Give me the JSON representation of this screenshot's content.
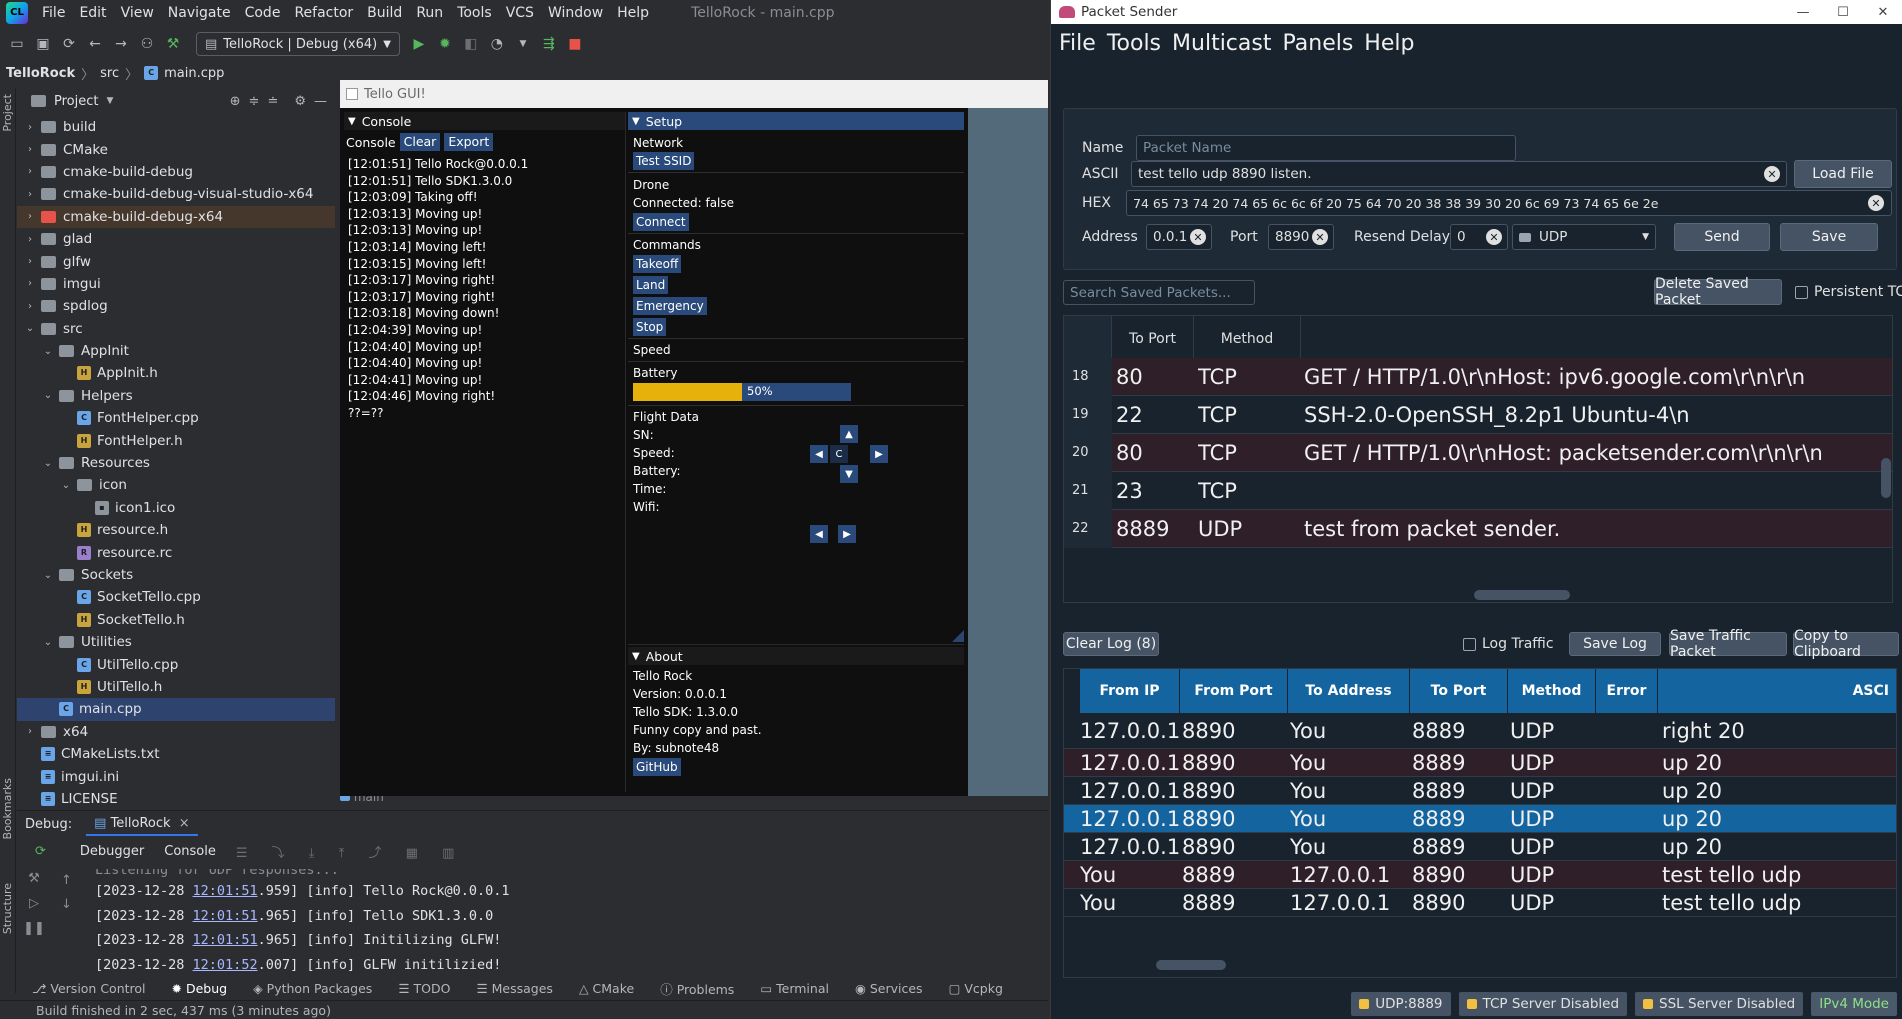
{
  "clion": {
    "menu": [
      "File",
      "Edit",
      "View",
      "Navigate",
      "Code",
      "Refactor",
      "Build",
      "Run",
      "Tools",
      "VCS",
      "Window",
      "Help"
    ],
    "window_title": "TelloRock - main.cpp",
    "run_config": "TelloRock | Debug (x64)",
    "breadcrumb": {
      "project": "TelloRock",
      "folder": "src",
      "file": "main.cpp"
    },
    "project_panel_title": "Project",
    "tree": [
      {
        "label": "build",
        "type": "folder",
        "depth": 1,
        "expanded": false
      },
      {
        "label": "CMake",
        "type": "folder",
        "depth": 1,
        "expanded": false
      },
      {
        "label": "cmake-build-debug",
        "type": "folder",
        "depth": 1,
        "expanded": false
      },
      {
        "label": "cmake-build-debug-visual-studio-x64",
        "type": "folder",
        "depth": 1,
        "expanded": false
      },
      {
        "label": "cmake-build-debug-x64",
        "type": "folder-red",
        "depth": 1,
        "expanded": false,
        "highlight": true
      },
      {
        "label": "glad",
        "type": "folder",
        "depth": 1,
        "expanded": false
      },
      {
        "label": "glfw",
        "type": "folder",
        "depth": 1,
        "expanded": false
      },
      {
        "label": "imgui",
        "type": "folder",
        "depth": 1,
        "expanded": false
      },
      {
        "label": "spdlog",
        "type": "folder",
        "depth": 1,
        "expanded": false
      },
      {
        "label": "src",
        "type": "folder",
        "depth": 1,
        "expanded": true
      },
      {
        "label": "AppInit",
        "type": "folder",
        "depth": 2,
        "expanded": true
      },
      {
        "label": "AppInit.h",
        "type": "h",
        "depth": 3
      },
      {
        "label": "Helpers",
        "type": "folder",
        "depth": 2,
        "expanded": true
      },
      {
        "label": "FontHelper.cpp",
        "type": "cpp",
        "depth": 3
      },
      {
        "label": "FontHelper.h",
        "type": "h",
        "depth": 3
      },
      {
        "label": "Resources",
        "type": "folder",
        "depth": 2,
        "expanded": true
      },
      {
        "label": "icon",
        "type": "folder",
        "depth": 3,
        "expanded": true
      },
      {
        "label": "icon1.ico",
        "type": "ico",
        "depth": 4
      },
      {
        "label": "resource.h",
        "type": "h",
        "depth": 3
      },
      {
        "label": "resource.rc",
        "type": "rc",
        "depth": 3
      },
      {
        "label": "Sockets",
        "type": "folder",
        "depth": 2,
        "expanded": true
      },
      {
        "label": "SocketTello.cpp",
        "type": "cpp",
        "depth": 3
      },
      {
        "label": "SocketTello.h",
        "type": "h",
        "depth": 3
      },
      {
        "label": "Utilities",
        "type": "folder",
        "depth": 2,
        "expanded": true
      },
      {
        "label": "UtilTello.cpp",
        "type": "cpp",
        "depth": 3
      },
      {
        "label": "UtilTello.h",
        "type": "h",
        "depth": 3
      },
      {
        "label": "main.cpp",
        "type": "cpp",
        "depth": 2,
        "selected": true
      },
      {
        "label": "x64",
        "type": "folder",
        "depth": 1,
        "expanded": false
      },
      {
        "label": "CMakeLists.txt",
        "type": "txt",
        "depth": 1
      },
      {
        "label": "imgui.ini",
        "type": "txt",
        "depth": 1
      },
      {
        "label": "LICENSE",
        "type": "txt",
        "depth": 1
      }
    ],
    "editor_tab": "main",
    "debug": {
      "label": "Debug:",
      "config_tab": "TelloRock",
      "subtabs": [
        "Debugger",
        "Console"
      ],
      "log_partial": "Listening for UDP responses...",
      "log": [
        {
          "date": "[2023-12-28 ",
          "time": "12:01:51",
          "rest": ".959] [info] Tello Rock@0.0.0.1"
        },
        {
          "date": "[2023-12-28 ",
          "time": "12:01:51",
          "rest": ".965] [info] Tello SDK1.3.0.0"
        },
        {
          "date": "[2023-12-28 ",
          "time": "12:01:51",
          "rest": ".965] [info] Initilizing GLFW!"
        },
        {
          "date": "[2023-12-28 ",
          "time": "12:01:52",
          "rest": ".007] [info] GLFW initilizied!"
        }
      ]
    },
    "side_labels": [
      "Project",
      "Bookmarks",
      "Structure"
    ],
    "bottom_tabs": [
      "Version Control",
      "Debug",
      "Python Packages",
      "TODO",
      "Messages",
      "CMake",
      "Problems",
      "Terminal",
      "Services",
      "Vcpkg"
    ],
    "status": "Build finished in 2 sec, 437 ms (3 minutes ago)"
  },
  "tello": {
    "title": "Tello GUI!",
    "console": {
      "header": "Console",
      "label": "Console",
      "clear": "Clear",
      "export": "Export",
      "lines": [
        "[12:01:51] Tello Rock@0.0.0.1",
        "[12:01:51] Tello SDK1.3.0.0",
        "[12:03:09] Taking off!",
        "[12:03:13] Moving up!",
        "[12:03:13] Moving up!",
        "[12:03:14] Moving left!",
        "[12:03:15] Moving left!",
        "[12:03:17] Moving right!",
        "[12:03:17] Moving right!",
        "[12:03:18] Moving down!",
        "[12:04:39] Moving up!",
        "[12:04:40] Moving up!",
        "[12:04:40] Moving up!",
        "[12:04:41] Moving up!",
        "[12:04:46] Moving right!",
        "??=??"
      ]
    },
    "setup": {
      "header": "Setup",
      "network": "Network",
      "test_ssid": "Test SSID",
      "drone": "Drone",
      "connected": "Connected: false",
      "connect": "Connect",
      "commands": "Commands",
      "takeoff": "Takeoff",
      "land": "Land",
      "emergency": "Emergency",
      "stop": "Stop",
      "speed": "Speed",
      "battery": "Battery",
      "battery_value": 0.5,
      "battery_label": "50%",
      "flight_data": "Flight Data",
      "sn": "SN:",
      "speed_label": "Speed:",
      "battery_label2": "Battery:",
      "time": "Time:",
      "wifi": "Wifi:",
      "center_btn": "C"
    },
    "about": {
      "header": "About",
      "name": "Tello Rock",
      "version": "Version: 0.0.0.1",
      "sdk": "Tello SDK: 1.3.0.0",
      "desc": "Funny copy and past.",
      "by": "By: subnote48",
      "github": "GitHub"
    }
  },
  "packet_sender": {
    "title": "Packet Sender",
    "menu": [
      "File",
      "Tools",
      "Multicast",
      "Panels",
      "Help"
    ],
    "form": {
      "name_label": "Name",
      "name_placeholder": "Packet Name",
      "ascii_label": "ASCII",
      "ascii_value": "test tello udp 8890 listen.",
      "load_file": "Load File",
      "hex_label": "HEX",
      "hex_value": "74 65 73 74 20 74 65 6c 6c 6f 20 75 64 70 20 38 38 39 30 20 6c 69 73 74 65 6e 2e",
      "address_label": "Address",
      "address_value": "0.0.1",
      "port_label": "Port",
      "port_value": "8890",
      "resend_label": "Resend Delay",
      "resend_value": "0",
      "protocol": "UDP",
      "send": "Send",
      "save": "Save"
    },
    "search_placeholder": "Search Saved Packets...",
    "delete_saved": "Delete Saved Packet",
    "persistent_tcp": "Persistent TCP",
    "saved_headers": [
      "To Port",
      "Method"
    ],
    "saved_rows": [
      {
        "idx": "18",
        "port": "80",
        "method": "TCP",
        "data": "GET / HTTP/1.0\\r\\nHost: ipv6.google.com\\r\\n\\r\\n"
      },
      {
        "idx": "19",
        "port": "22",
        "method": "TCP",
        "data": "SSH-2.0-OpenSSH_8.2p1 Ubuntu-4\\n"
      },
      {
        "idx": "20",
        "port": "80",
        "method": "TCP",
        "data": "GET / HTTP/1.0\\r\\nHost: packetsender.com\\r\\n\\r\\n"
      },
      {
        "idx": "21",
        "port": "23",
        "method": "TCP",
        "data": ""
      },
      {
        "idx": "22",
        "port": "8889",
        "method": "UDP",
        "data": "test from packet sender."
      }
    ],
    "clear_log": "Clear Log (8)",
    "log_traffic": "Log Traffic",
    "save_log": "Save Log",
    "save_traffic": "Save Traffic Packet",
    "copy_clipboard": "Copy to Clipboard",
    "log_headers": [
      "From IP",
      "From Port",
      "To Address",
      "To Port",
      "Method",
      "Error",
      "ASCI"
    ],
    "log_rows": [
      {
        "from_ip": "127.0.0.1",
        "from_port": "8890",
        "to_addr": "You",
        "to_port": "8889",
        "method": "UDP",
        "error": "",
        "ascii": "right 20"
      },
      {
        "from_ip": "127.0.0.1",
        "from_port": "8890",
        "to_addr": "You",
        "to_port": "8889",
        "method": "UDP",
        "error": "",
        "ascii": "up 20"
      },
      {
        "from_ip": "127.0.0.1",
        "from_port": "8890",
        "to_addr": "You",
        "to_port": "8889",
        "method": "UDP",
        "error": "",
        "ascii": "up 20"
      },
      {
        "from_ip": "127.0.0.1",
        "from_port": "8890",
        "to_addr": "You",
        "to_port": "8889",
        "method": "UDP",
        "error": "",
        "ascii": "up 20"
      },
      {
        "from_ip": "127.0.0.1",
        "from_port": "8890",
        "to_addr": "You",
        "to_port": "8889",
        "method": "UDP",
        "error": "",
        "ascii": "up 20"
      },
      {
        "from_ip": "You",
        "from_port": "8889",
        "to_addr": "127.0.0.1",
        "to_port": "8890",
        "method": "UDP",
        "error": "",
        "ascii": "test tello udp"
      },
      {
        "from_ip": "You",
        "from_port": "8889",
        "to_addr": "127.0.0.1",
        "to_port": "8890",
        "method": "UDP",
        "error": "",
        "ascii": "test tello udp"
      }
    ],
    "status": {
      "udp": "UDP:8889",
      "tcp": "TCP Server Disabled",
      "ssl": "SSL Server Disabled",
      "ipv": "IPv4 Mode"
    }
  }
}
